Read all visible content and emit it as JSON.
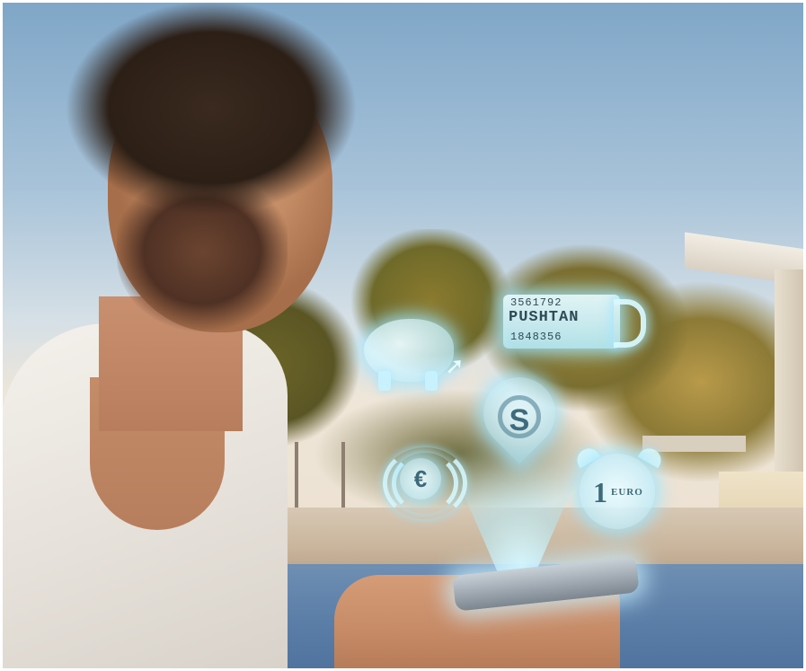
{
  "scene": {
    "description_alt": "",
    "colors": {
      "sky": "#a8c3d9",
      "hologram_glow": "#bff4ff",
      "pool": "#5c7fa8",
      "shirt": "#ece8e2"
    }
  },
  "hologram": {
    "tan_generator": {
      "top_digits": "3561792",
      "word": "PUSHTAN",
      "bottom_digits": "1848356"
    },
    "bank_pin_glyph": "S",
    "contactless_symbol": "€",
    "alarm_coin": {
      "number": "1",
      "unit": "EURO"
    },
    "icons": [
      "piggy-bank-icon",
      "lock-icon",
      "location-pin-icon",
      "contactless-payment-icon",
      "alarm-clock-icon",
      "cursor-icon"
    ]
  }
}
